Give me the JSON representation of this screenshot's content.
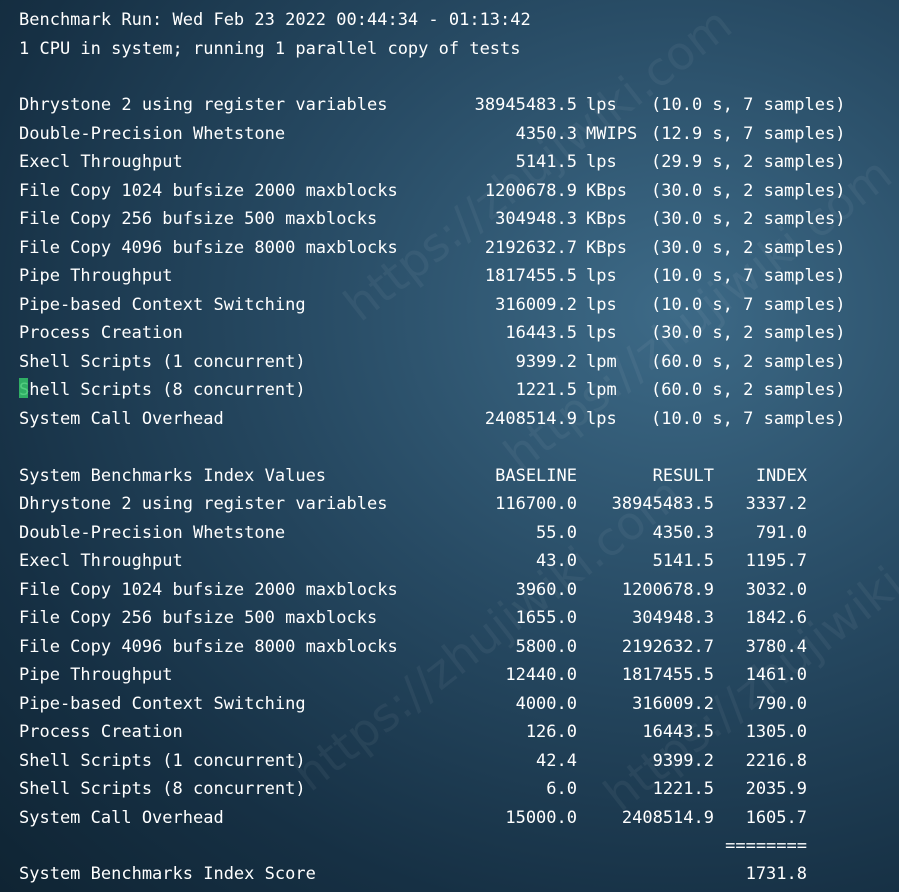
{
  "header": {
    "run_line": "Benchmark Run: Wed Feb 23 2022 00:44:34 - 01:13:42",
    "cpu_line": "1 CPU in system; running 1 parallel copy of tests"
  },
  "results": [
    {
      "name": "Dhrystone 2 using register variables",
      "value": "38945483.5",
      "unit": "lps",
      "timing": "(10.0 s, 7 samples)"
    },
    {
      "name": "Double-Precision Whetstone",
      "value": "4350.3",
      "unit": "MWIPS",
      "timing": "(12.9 s, 7 samples)"
    },
    {
      "name": "Execl Throughput",
      "value": "5141.5",
      "unit": "lps",
      "timing": "(29.9 s, 2 samples)"
    },
    {
      "name": "File Copy 1024 bufsize 2000 maxblocks",
      "value": "1200678.9",
      "unit": "KBps",
      "timing": "(30.0 s, 2 samples)"
    },
    {
      "name": "File Copy 256 bufsize 500 maxblocks",
      "value": "304948.3",
      "unit": "KBps",
      "timing": "(30.0 s, 2 samples)"
    },
    {
      "name": "File Copy 4096 bufsize 8000 maxblocks",
      "value": "2192632.7",
      "unit": "KBps",
      "timing": "(30.0 s, 2 samples)"
    },
    {
      "name": "Pipe Throughput",
      "value": "1817455.5",
      "unit": "lps",
      "timing": "(10.0 s, 7 samples)"
    },
    {
      "name": "Pipe-based Context Switching",
      "value": "316009.2",
      "unit": "lps",
      "timing": "(10.0 s, 7 samples)"
    },
    {
      "name": "Process Creation",
      "value": "16443.5",
      "unit": "lps",
      "timing": "(30.0 s, 2 samples)"
    },
    {
      "name": "Shell Scripts (1 concurrent)",
      "value": "9399.2",
      "unit": "lpm",
      "timing": "(60.0 s, 2 samples)"
    },
    {
      "name": "Shell Scripts (8 concurrent)",
      "value": "1221.5",
      "unit": "lpm",
      "timing": "(60.0 s, 2 samples)"
    },
    {
      "name": "System Call Overhead",
      "value": "2408514.9",
      "unit": "lps",
      "timing": "(10.0 s, 7 samples)"
    }
  ],
  "index_table": {
    "title": "System Benchmarks Index Values",
    "col_baseline": "BASELINE",
    "col_result": "RESULT",
    "col_index": "INDEX",
    "rows": [
      {
        "name": "Dhrystone 2 using register variables",
        "baseline": "116700.0",
        "result": "38945483.5",
        "index": "3337.2"
      },
      {
        "name": "Double-Precision Whetstone",
        "baseline": "55.0",
        "result": "4350.3",
        "index": "791.0"
      },
      {
        "name": "Execl Throughput",
        "baseline": "43.0",
        "result": "5141.5",
        "index": "1195.7"
      },
      {
        "name": "File Copy 1024 bufsize 2000 maxblocks",
        "baseline": "3960.0",
        "result": "1200678.9",
        "index": "3032.0"
      },
      {
        "name": "File Copy 256 bufsize 500 maxblocks",
        "baseline": "1655.0",
        "result": "304948.3",
        "index": "1842.6"
      },
      {
        "name": "File Copy 4096 bufsize 8000 maxblocks",
        "baseline": "5800.0",
        "result": "2192632.7",
        "index": "3780.4"
      },
      {
        "name": "Pipe Throughput",
        "baseline": "12440.0",
        "result": "1817455.5",
        "index": "1461.0"
      },
      {
        "name": "Pipe-based Context Switching",
        "baseline": "4000.0",
        "result": "316009.2",
        "index": "790.0"
      },
      {
        "name": "Process Creation",
        "baseline": "126.0",
        "result": "16443.5",
        "index": "1305.0"
      },
      {
        "name": "Shell Scripts (1 concurrent)",
        "baseline": "42.4",
        "result": "9399.2",
        "index": "2216.8"
      },
      {
        "name": "Shell Scripts (8 concurrent)",
        "baseline": "6.0",
        "result": "1221.5",
        "index": "2035.9"
      },
      {
        "name": "System Call Overhead",
        "baseline": "15000.0",
        "result": "2408514.9",
        "index": "1605.7"
      }
    ],
    "separator": "========",
    "score_label": "System Benchmarks Index Score",
    "score_value": "1731.8"
  },
  "watermark_text": "https://zhujiwiki.com",
  "colors": {
    "text": "#ffffff",
    "cursor": "#35c46a",
    "background": "#274a63"
  }
}
